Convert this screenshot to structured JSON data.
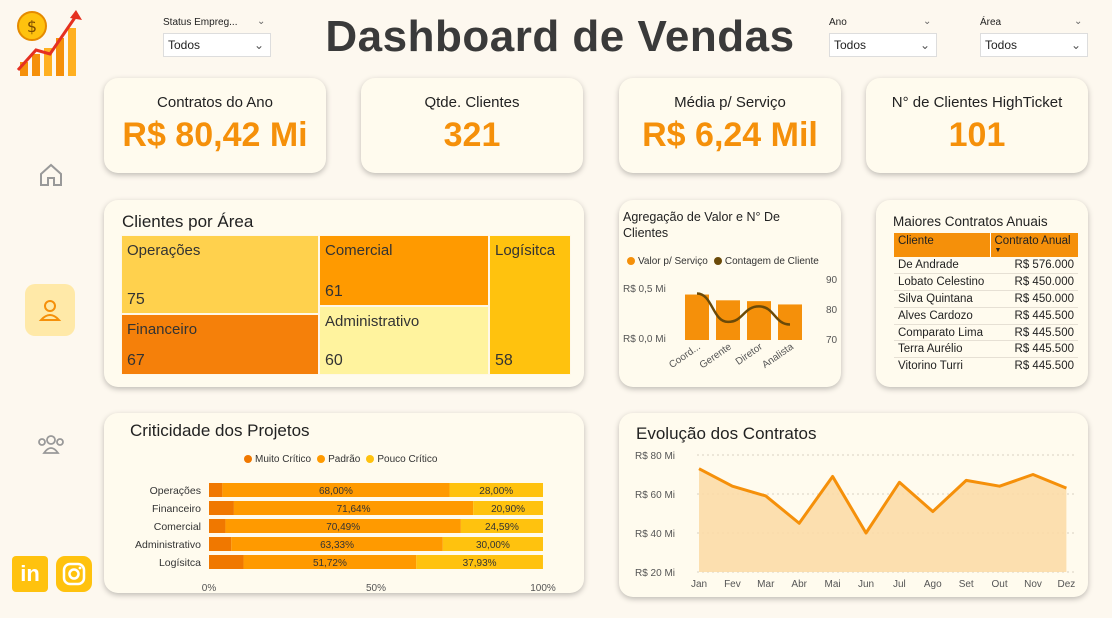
{
  "header": {
    "title": "Dashboard de Vendas"
  },
  "filters": [
    {
      "label": "Status Empreg...",
      "value": "Todos"
    },
    {
      "label": "Ano",
      "value": "Todos"
    },
    {
      "label": "Área",
      "value": "Todos"
    }
  ],
  "kpis": [
    {
      "title": "Contratos do Ano",
      "value": "R$ 80,42 Mi"
    },
    {
      "title": "Qtde. Clientes",
      "value": "321"
    },
    {
      "title": "Média p/ Serviço",
      "value": "R$ 6,24 Mil"
    },
    {
      "title": "N° de Clientes HighTicket",
      "value": "101"
    }
  ],
  "treemap": {
    "title": "Clientes por Área",
    "items": [
      {
        "label": "Operações",
        "value": "75",
        "color": "#ffd14d"
      },
      {
        "label": "Financeiro",
        "value": "67",
        "color": "#f5800a"
      },
      {
        "label": "Comercial",
        "value": "61",
        "color": "#ff9a00"
      },
      {
        "label": "Administrativo",
        "value": "60",
        "color": "#fff39e"
      },
      {
        "label": "Logísitca",
        "value": "58",
        "color": "#ffc20e"
      }
    ]
  },
  "combo": {
    "title_line1": "Agregação de Valor e N° De",
    "title_line2": "Clientes",
    "legend": [
      "Valor p/ Serviço",
      "Contagem de Cliente"
    ],
    "legend_colors": [
      "#f5900a",
      "#6b4a08"
    ],
    "y_left_ticks": [
      "R$ 0,5 Mi",
      "R$ 0,0 Mi"
    ],
    "y_right_ticks": [
      "90",
      "80",
      "70"
    ]
  },
  "top_contracts": {
    "title": "Maiores Contratos Anuais",
    "headers": [
      "Cliente",
      "Contrato Anual"
    ],
    "rows": [
      [
        "De Andrade",
        "R$ 576.000"
      ],
      [
        "Lobato Celestino",
        "R$ 450.000"
      ],
      [
        "Silva Quintana",
        "R$ 450.000"
      ],
      [
        "Alves Cardozo",
        "R$ 445.500"
      ],
      [
        "Comparato Lima",
        "R$ 445.500"
      ],
      [
        "Terra Aurélio",
        "R$ 445.500"
      ],
      [
        "Vitorino Turri",
        "R$ 445.500"
      ]
    ]
  },
  "criticality": {
    "title": "Criticidade dos Projetos",
    "legend": [
      "Muito Crítico",
      "Padrão",
      "Pouco Crítico"
    ],
    "colors": [
      "#f07800",
      "#ff9a00",
      "#ffc20e"
    ],
    "x_ticks": [
      "0%",
      "50%",
      "100%"
    ]
  },
  "evolution": {
    "title": "Evolução dos Contratos",
    "y_ticks": [
      "R$ 80 Mi",
      "R$ 60 Mi",
      "R$ 40 Mi",
      "R$ 20 Mi"
    ]
  },
  "chart_data": [
    {
      "type": "bar",
      "title": "Agregação de Valor e N° De Clientes",
      "categories": [
        "Coord...",
        "Gerente",
        "Diretor",
        "Analista"
      ],
      "series": [
        {
          "name": "Valor p/ Serviço",
          "values": [
            0.55,
            0.48,
            0.47,
            0.43
          ],
          "unit": "R$ Mi"
        },
        {
          "name": "Contagem de Cliente",
          "values": [
            86,
            75,
            81,
            74
          ],
          "kind": "line",
          "axis": "right"
        }
      ],
      "ylim_left": [
        0,
        0.75
      ],
      "ylim_right": [
        68,
        92
      ]
    },
    {
      "type": "bar",
      "orientation": "horizontal",
      "stacked": true,
      "title": "Criticidade dos Projetos",
      "categories": [
        "Operações",
        "Financeiro",
        "Comercial",
        "Administrativo",
        "Logísitca"
      ],
      "series": [
        {
          "name": "Muito Crítico",
          "values": [
            4.0,
            7.46,
            4.92,
            6.67,
            10.34
          ]
        },
        {
          "name": "Padrão",
          "values": [
            68.0,
            71.64,
            70.49,
            63.33,
            51.72
          ]
        },
        {
          "name": "Pouco Crítico",
          "values": [
            28.0,
            20.9,
            24.59,
            30.0,
            37.93
          ]
        }
      ],
      "labels": [
        [
          "68,00%",
          "28,00%"
        ],
        [
          "71,64%",
          "20,90%"
        ],
        [
          "70,49%",
          "24,59%"
        ],
        [
          "63,33%",
          "30,00%"
        ],
        [
          "51,72%",
          "37,93%"
        ]
      ],
      "xlim": [
        0,
        100
      ]
    },
    {
      "type": "area",
      "title": "Evolução dos Contratos",
      "x": [
        "Jan",
        "Fev",
        "Mar",
        "Abr",
        "Mai",
        "Jun",
        "Jul",
        "Ago",
        "Set",
        "Out",
        "Nov",
        "Dez"
      ],
      "values": [
        73,
        64,
        59,
        45,
        69,
        40,
        66,
        51,
        67,
        64,
        70,
        63
      ],
      "unit": "R$ Mi",
      "ylim": [
        20,
        80
      ]
    }
  ],
  "sidebar": {
    "items": [
      {
        "icon": "home-icon"
      },
      {
        "icon": "user-icon",
        "active": true
      },
      {
        "icon": "group-icon"
      }
    ],
    "social": [
      "linkedin-icon",
      "instagram-icon"
    ]
  }
}
